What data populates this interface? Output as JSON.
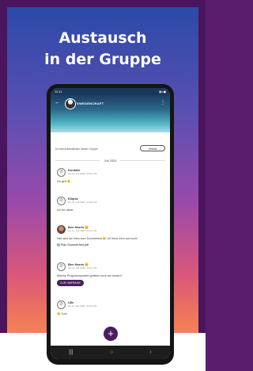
{
  "headline": {
    "line1": "Austausch",
    "line2": "in der Gruppe"
  },
  "phone": {
    "status": {
      "time": "11:11",
      "icons": "▮◂ ◼"
    },
    "header": {
      "back": "←",
      "group_name": "SWEDENCRAFT",
      "menu": "⋮"
    },
    "top_row": {
      "text": "Du bist Administrator dieser Gruppe",
      "button": "Details"
    },
    "date_separator": "Juli 2024",
    "messages": [
      {
        "name": "Kontakt",
        "date": "am 11. Juli 2024, 10:51 Uhr",
        "text": "Ich geh 🙂"
      },
      {
        "name": "Ellipse",
        "date": "am 11. Juli 2024, 10:55 Uhr",
        "text": "Ich bin dabei"
      },
      {
        "name": "Ben Harris 😊",
        "date": "am 11. Juli 2024, 10:11 Uhr",
        "text": "Hier sind die Infos zum Sommerfest 🙂 Ich freue mich auf euch!",
        "file": "Plan Sommerfest.pdf"
      },
      {
        "name": "Ben Harris 😊",
        "date": "am 11. Juli 2024, 10:11 Uhr",
        "text": "Welche Programmpunkte gefallen euch am besten?",
        "button": "ZUR UMFRAGE"
      },
      {
        "name": "Ulle",
        "date": "am 11. Juli 2024, 11:04 Uhr",
        "text": "🙂 Cool"
      }
    ],
    "fab": "+",
    "nav": {
      "recent": "|||",
      "home": "○",
      "back": "‹"
    }
  }
}
